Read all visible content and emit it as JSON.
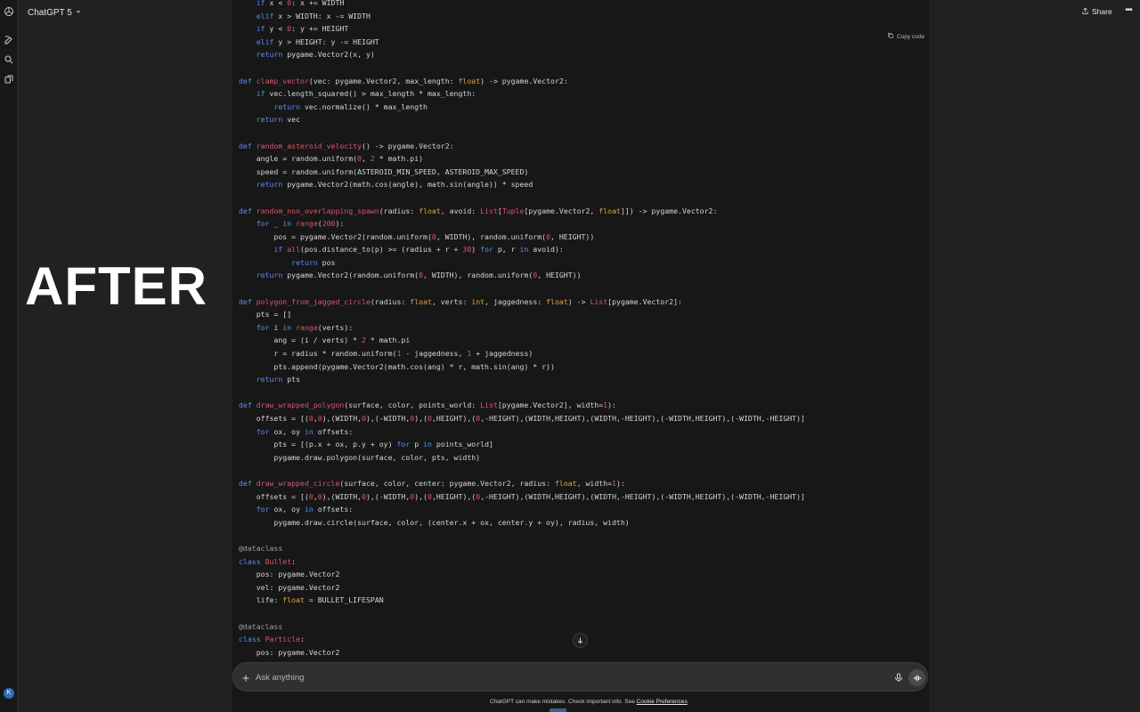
{
  "header": {
    "model_label": "ChatGPT 5",
    "share_label": "Share",
    "more_label": "•••"
  },
  "sidebar": {
    "avatar_initial": "K"
  },
  "overlay": {
    "label": "AFTER"
  },
  "code_block": {
    "copy_label": "Copy code",
    "lines": [
      [
        [
          "    ",
          ""
        ],
        [
          "if",
          "kw"
        ],
        [
          " x < ",
          ""
        ],
        [
          "0",
          "num"
        ],
        [
          ": x += WIDTH",
          ""
        ]
      ],
      [
        [
          "    ",
          ""
        ],
        [
          "elif",
          "kw"
        ],
        [
          " x > WIDTH: x -= WIDTH",
          ""
        ]
      ],
      [
        [
          "    ",
          ""
        ],
        [
          "if",
          "kw"
        ],
        [
          " y < ",
          ""
        ],
        [
          "0",
          "num"
        ],
        [
          ": y += HEIGHT",
          ""
        ]
      ],
      [
        [
          "    ",
          ""
        ],
        [
          "elif",
          "kw"
        ],
        [
          " y > HEIGHT: y -= HEIGHT",
          ""
        ]
      ],
      [
        [
          "    ",
          ""
        ],
        [
          "return",
          "kw"
        ],
        [
          " pygame.Vector2(x, y)",
          ""
        ]
      ],
      [],
      [
        [
          "def",
          "kw"
        ],
        [
          " ",
          ""
        ],
        [
          "clamp_vector",
          "fn"
        ],
        [
          "(vec: pygame.Vector2, max_length: ",
          ""
        ],
        [
          "float",
          "ty"
        ],
        [
          ") -> pygame.Vector2:",
          ""
        ]
      ],
      [
        [
          "    ",
          ""
        ],
        [
          "if",
          "kw"
        ],
        [
          " vec.length_squared() > max_length * max_length:",
          ""
        ]
      ],
      [
        [
          "        ",
          ""
        ],
        [
          "return",
          "kw"
        ],
        [
          " vec.normalize() * max_length",
          ""
        ]
      ],
      [
        [
          "    ",
          ""
        ],
        [
          "return",
          "kw"
        ],
        [
          " vec",
          ""
        ]
      ],
      [],
      [
        [
          "def",
          "kw"
        ],
        [
          " ",
          ""
        ],
        [
          "random_asteroid_velocity",
          "fn"
        ],
        [
          "() -> pygame.Vector2:",
          ""
        ]
      ],
      [
        [
          "    angle = random.uniform(",
          ""
        ],
        [
          "0",
          "num"
        ],
        [
          ", ",
          ""
        ],
        [
          "2",
          "num"
        ],
        [
          " * math.pi)",
          ""
        ]
      ],
      [
        [
          "    speed = random.uniform(ASTEROID_MIN_SPEED, ASTEROID_MAX_SPEED)",
          ""
        ]
      ],
      [
        [
          "    ",
          ""
        ],
        [
          "return",
          "kw"
        ],
        [
          " pygame.Vector2(math.cos(angle), math.sin(angle)) * speed",
          ""
        ]
      ],
      [],
      [
        [
          "def",
          "kw"
        ],
        [
          " ",
          ""
        ],
        [
          "random_non_overlapping_spawn",
          "fn"
        ],
        [
          "(radius: ",
          ""
        ],
        [
          "float",
          "ty"
        ],
        [
          ", avoid: ",
          ""
        ],
        [
          "List",
          "fn"
        ],
        [
          "[",
          ""
        ],
        [
          "Tuple",
          "fn"
        ],
        [
          "[pygame.Vector2, ",
          ""
        ],
        [
          "float",
          "ty"
        ],
        [
          "]]) -> pygame.Vector2:",
          ""
        ]
      ],
      [
        [
          "    ",
          ""
        ],
        [
          "for",
          "kw"
        ],
        [
          " _ ",
          ""
        ],
        [
          "in",
          "kw"
        ],
        [
          " ",
          ""
        ],
        [
          "range",
          "fn"
        ],
        [
          "(",
          ""
        ],
        [
          "200",
          "num"
        ],
        [
          "):",
          ""
        ]
      ],
      [
        [
          "        pos = pygame.Vector2(random.uniform(",
          ""
        ],
        [
          "0",
          "num"
        ],
        [
          ", WIDTH), random.uniform(",
          ""
        ],
        [
          "0",
          "num"
        ],
        [
          ", HEIGHT))",
          ""
        ]
      ],
      [
        [
          "        ",
          ""
        ],
        [
          "if",
          "kw"
        ],
        [
          " ",
          ""
        ],
        [
          "all",
          "fn"
        ],
        [
          "(pos.distance_to(p) >= (radius + r + ",
          ""
        ],
        [
          "30",
          "num"
        ],
        [
          ") ",
          ""
        ],
        [
          "for",
          "kw"
        ],
        [
          " p, r ",
          ""
        ],
        [
          "in",
          "kw"
        ],
        [
          " avoid):",
          ""
        ]
      ],
      [
        [
          "            ",
          ""
        ],
        [
          "return",
          "kw"
        ],
        [
          " pos",
          ""
        ]
      ],
      [
        [
          "    ",
          ""
        ],
        [
          "return",
          "kw"
        ],
        [
          " pygame.Vector2(random.uniform(",
          ""
        ],
        [
          "0",
          "num"
        ],
        [
          ", WIDTH), random.uniform(",
          ""
        ],
        [
          "0",
          "num"
        ],
        [
          ", HEIGHT))",
          ""
        ]
      ],
      [],
      [
        [
          "def",
          "kw"
        ],
        [
          " ",
          ""
        ],
        [
          "polygon_from_jagged_circle",
          "fn"
        ],
        [
          "(radius: ",
          ""
        ],
        [
          "float",
          "ty"
        ],
        [
          ", verts: ",
          ""
        ],
        [
          "int",
          "ty"
        ],
        [
          ", jaggedness: ",
          ""
        ],
        [
          "float",
          "ty"
        ],
        [
          ") -> ",
          ""
        ],
        [
          "List",
          "fn"
        ],
        [
          "[pygame.Vector2]:",
          ""
        ]
      ],
      [
        [
          "    pts = []",
          ""
        ]
      ],
      [
        [
          "    ",
          ""
        ],
        [
          "for",
          "kw"
        ],
        [
          " i ",
          ""
        ],
        [
          "in",
          "kw"
        ],
        [
          " ",
          ""
        ],
        [
          "range",
          "fn"
        ],
        [
          "(verts):",
          ""
        ]
      ],
      [
        [
          "        ang = (i / verts) * ",
          ""
        ],
        [
          "2",
          "num"
        ],
        [
          " * math.pi",
          ""
        ]
      ],
      [
        [
          "        r = radius * random.uniform(",
          ""
        ],
        [
          "1",
          "num"
        ],
        [
          " - jaggedness, ",
          ""
        ],
        [
          "1",
          "num"
        ],
        [
          " + jaggedness)",
          ""
        ]
      ],
      [
        [
          "        pts.append(pygame.Vector2(math.cos(ang) * r, math.sin(ang) * r))",
          ""
        ]
      ],
      [
        [
          "    ",
          ""
        ],
        [
          "return",
          "kw"
        ],
        [
          " pts",
          ""
        ]
      ],
      [],
      [
        [
          "def",
          "kw"
        ],
        [
          " ",
          ""
        ],
        [
          "draw_wrapped_polygon",
          "fn"
        ],
        [
          "(surface, color, points_world: ",
          ""
        ],
        [
          "List",
          "fn"
        ],
        [
          "[pygame.Vector2], width=",
          ""
        ],
        [
          "1",
          "num"
        ],
        [
          "):",
          ""
        ]
      ],
      [
        [
          "    offsets = [(",
          ""
        ],
        [
          "0",
          "num"
        ],
        [
          ",",
          ""
        ],
        [
          "0",
          "num"
        ],
        [
          "),(WIDTH,",
          ""
        ],
        [
          "0",
          "num"
        ],
        [
          "),(-WIDTH,",
          ""
        ],
        [
          "0",
          "num"
        ],
        [
          "),(",
          ""
        ],
        [
          "0",
          "num"
        ],
        [
          ",HEIGHT),(",
          ""
        ],
        [
          "0",
          "num"
        ],
        [
          ",-HEIGHT),(WIDTH,HEIGHT),(WIDTH,-HEIGHT),(-WIDTH,HEIGHT),(-WIDTH,-HEIGHT)]",
          ""
        ]
      ],
      [
        [
          "    ",
          ""
        ],
        [
          "for",
          "kw"
        ],
        [
          " ox, oy ",
          ""
        ],
        [
          "in",
          "kw"
        ],
        [
          " offsets:",
          ""
        ]
      ],
      [
        [
          "        pts = [(p.x + ox, p.y + oy) ",
          ""
        ],
        [
          "for",
          "kw"
        ],
        [
          " p ",
          ""
        ],
        [
          "in",
          "kw"
        ],
        [
          " points_world]",
          ""
        ]
      ],
      [
        [
          "        pygame.draw.polygon(surface, color, pts, width)",
          ""
        ]
      ],
      [],
      [
        [
          "def",
          "kw"
        ],
        [
          " ",
          ""
        ],
        [
          "draw_wrapped_circle",
          "fn"
        ],
        [
          "(surface, color, center: pygame.Vector2, radius: ",
          ""
        ],
        [
          "float",
          "ty"
        ],
        [
          ", width=",
          ""
        ],
        [
          "1",
          "num"
        ],
        [
          "):",
          ""
        ]
      ],
      [
        [
          "    offsets = [(",
          ""
        ],
        [
          "0",
          "num"
        ],
        [
          ",",
          ""
        ],
        [
          "0",
          "num"
        ],
        [
          "),(WIDTH,",
          ""
        ],
        [
          "0",
          "num"
        ],
        [
          "),(-WIDTH,",
          ""
        ],
        [
          "0",
          "num"
        ],
        [
          "),(",
          ""
        ],
        [
          "0",
          "num"
        ],
        [
          ",HEIGHT),(",
          ""
        ],
        [
          "0",
          "num"
        ],
        [
          ",-HEIGHT),(WIDTH,HEIGHT),(WIDTH,-HEIGHT),(-WIDTH,HEIGHT),(-WIDTH,-HEIGHT)]",
          ""
        ]
      ],
      [
        [
          "    ",
          ""
        ],
        [
          "for",
          "kw"
        ],
        [
          " ox, oy ",
          ""
        ],
        [
          "in",
          "kw"
        ],
        [
          " offsets:",
          ""
        ]
      ],
      [
        [
          "        pygame.draw.circle(surface, color, (center.x + ox, center.y + oy), radius, width)",
          ""
        ]
      ],
      [],
      [
        [
          "@dataclass",
          "dec"
        ]
      ],
      [
        [
          "class",
          "kw"
        ],
        [
          " ",
          ""
        ],
        [
          "Bullet",
          "cls"
        ],
        [
          ":",
          ""
        ]
      ],
      [
        [
          "    pos: pygame.Vector2",
          ""
        ]
      ],
      [
        [
          "    vel: pygame.Vector2",
          ""
        ]
      ],
      [
        [
          "    life: ",
          ""
        ],
        [
          "float",
          "ty"
        ],
        [
          " = BULLET_LIFESPAN",
          ""
        ]
      ],
      [],
      [
        [
          "@dataclass",
          "dec"
        ]
      ],
      [
        [
          "class",
          "kw"
        ],
        [
          " ",
          ""
        ],
        [
          "Particle",
          "cls"
        ],
        [
          ":",
          ""
        ]
      ],
      [
        [
          "    pos: pygame.Vector2",
          ""
        ]
      ]
    ]
  },
  "composer": {
    "placeholder": "Ask anything"
  },
  "footer": {
    "note": "ChatGPT can make mistakes. Check important info. See ",
    "link": "Cookie Preferences",
    "suffix": "."
  }
}
